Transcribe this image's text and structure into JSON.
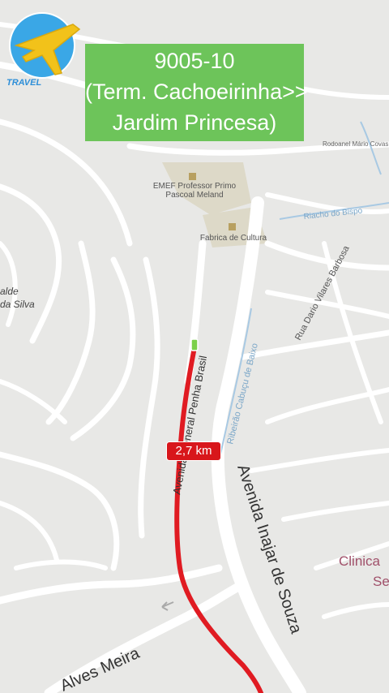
{
  "title": {
    "line1": "9005-10",
    "line2": "(Term. Cachoeirinha>>",
    "line3": "Jardim Princesa)"
  },
  "logo": {
    "text": "TRAVEL"
  },
  "route": {
    "distance_label": "2,7 km",
    "color": "#e01b22"
  },
  "map_labels": {
    "school": "EMEF Professor Primo",
    "school2": "Pascoal Meland",
    "cultura": "Fabrica de Cultura",
    "riacho": "Riacho do Bispo",
    "rodoanel": "Rodoanel Mário Covas",
    "dario": "Rua Dario Vilares Barbosa",
    "ribeirao": "Ribeirão Cabuçu de Baixo",
    "inajar": "Avenida Inajar de Souza",
    "general": "Avenida General Penha Brasil",
    "alves": "Alves Meira",
    "clinica": "Clinica",
    "clinica2": "Se",
    "silva1": "alde",
    "silva2": "da Silva"
  },
  "colors": {
    "title_bg": "#6dc45a",
    "road": "#ffffff",
    "land": "#e8e8e6",
    "water": "#a8c9e3"
  }
}
